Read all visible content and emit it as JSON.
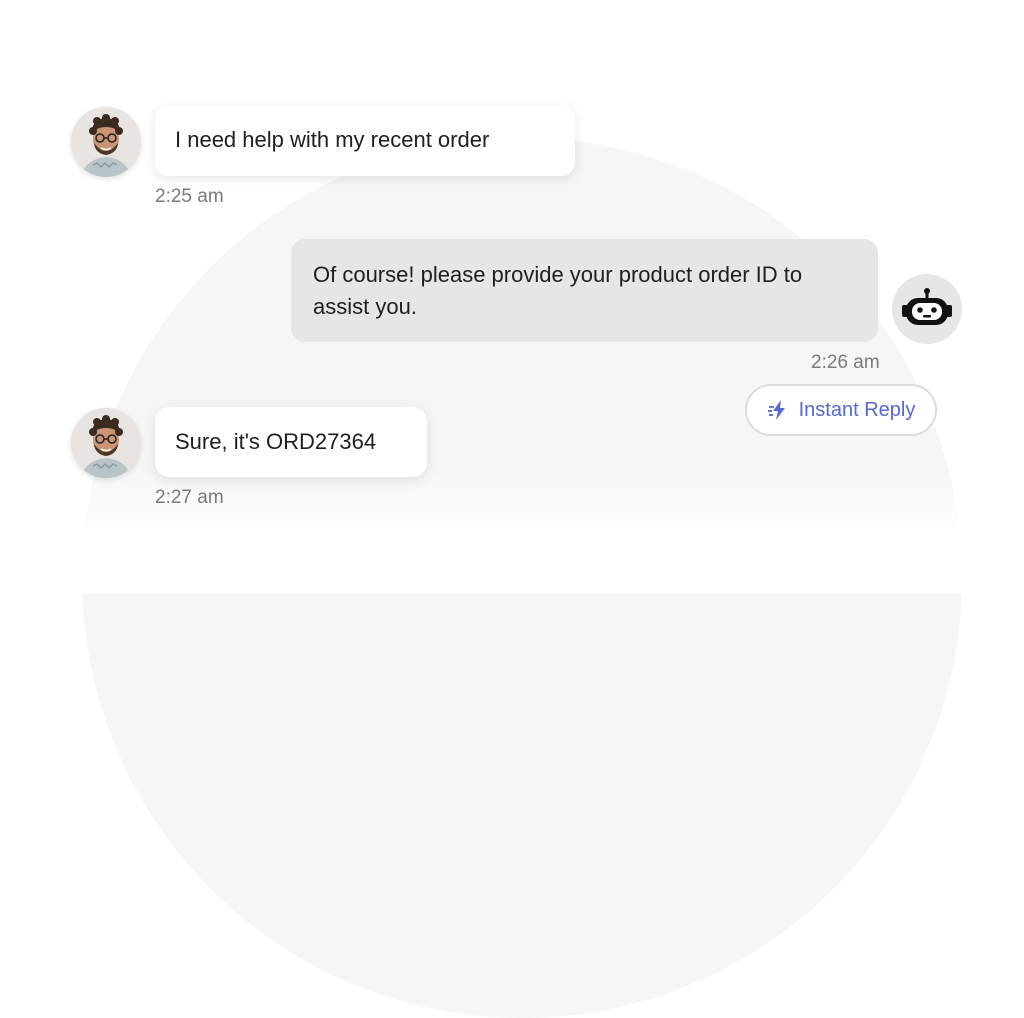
{
  "messages": [
    {
      "sender": "user",
      "text": "I need help with my recent order",
      "time": "2:25 am",
      "avatar_icon": "user-avatar"
    },
    {
      "sender": "bot",
      "text": "Of course! please provide your product order ID to assist you.",
      "time": "2:26 am",
      "avatar_icon": "robot-icon"
    },
    {
      "sender": "user",
      "text": "Sure, it's ORD27364",
      "time": "2:27 am",
      "avatar_icon": "user-avatar"
    }
  ],
  "instant_reply": {
    "label": "Instant Reply",
    "icon": "lightning-bolt-icon"
  },
  "colors": {
    "accent": "#5468d6",
    "bot_bubble": "#e6e6e6",
    "user_bubble": "#ffffff",
    "timestamp": "#7a7a7a",
    "background_arc": "#f6f6f6"
  }
}
